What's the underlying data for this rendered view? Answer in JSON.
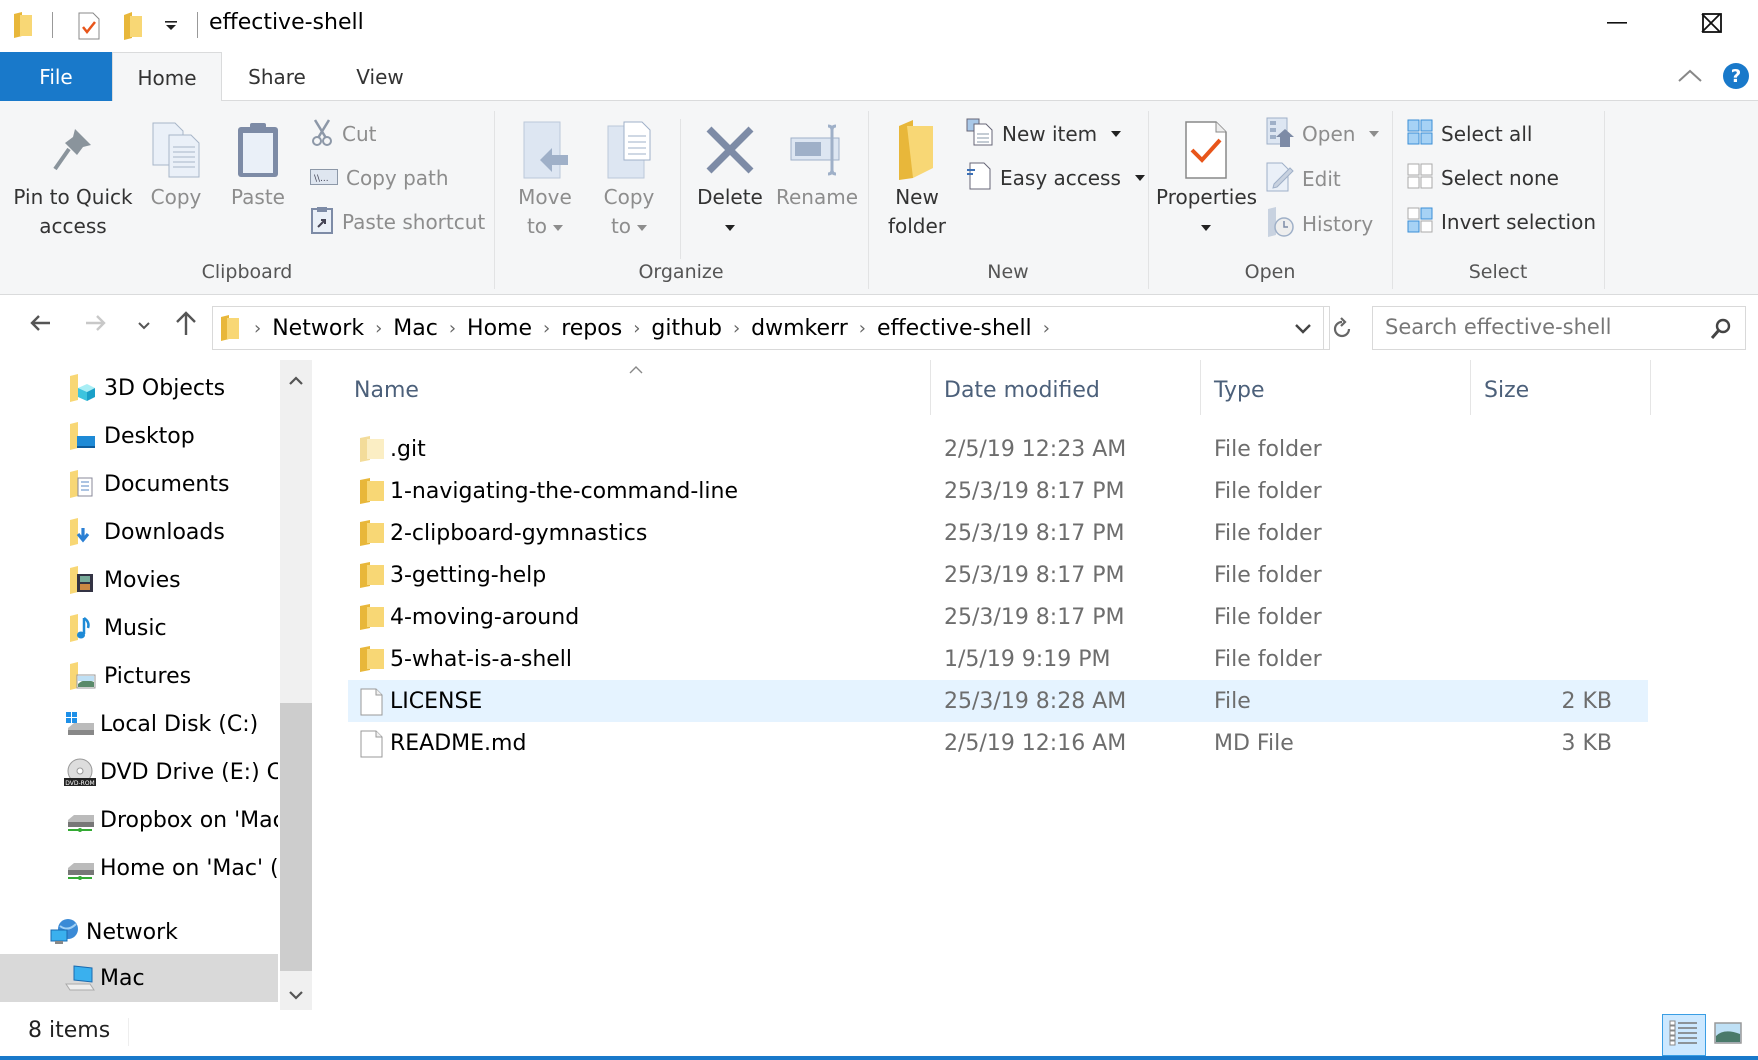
{
  "window": {
    "title": "effective-shell",
    "controls": {
      "minimize": "minimize",
      "maximize": "maximize",
      "close": "close"
    }
  },
  "quick_access_toolbar": {
    "icons": [
      "folder-icon",
      "properties-icon",
      "new-folder-icon",
      "customize-dropdown-icon"
    ]
  },
  "ribbon_tabs": [
    {
      "label": "File"
    },
    {
      "label": "Home",
      "active": true
    },
    {
      "label": "Share"
    },
    {
      "label": "View"
    }
  ],
  "ribbon": {
    "clipboard": {
      "label": "Clipboard",
      "pin_to_quick_access": [
        "Pin to Quick",
        "access"
      ],
      "copy": "Copy",
      "paste": "Paste",
      "cut": "Cut",
      "copy_path": "Copy path",
      "paste_shortcut": "Paste shortcut"
    },
    "organize": {
      "label": "Organize",
      "move_to": [
        "Move",
        "to"
      ],
      "copy_to": [
        "Copy",
        "to"
      ],
      "delete": "Delete",
      "rename": "Rename"
    },
    "new": {
      "label": "New",
      "new_folder": [
        "New",
        "folder"
      ],
      "new_item": "New item",
      "easy_access": "Easy access"
    },
    "open": {
      "label": "Open",
      "properties": "Properties",
      "open": "Open",
      "edit": "Edit",
      "history": "History"
    },
    "select": {
      "label": "Select",
      "select_all": "Select all",
      "select_none": "Select none",
      "invert_selection": "Invert selection"
    }
  },
  "address_bar": {
    "breadcrumbs": [
      "Network",
      "Mac",
      "Home",
      "repos",
      "github",
      "dwmkerr",
      "effective-shell"
    ]
  },
  "search": {
    "placeholder": "Search effective-shell",
    "value": ""
  },
  "sidebar": {
    "items": [
      {
        "label": "3D Objects",
        "icon": "3d-objects-icon"
      },
      {
        "label": "Desktop",
        "icon": "desktop-icon"
      },
      {
        "label": "Documents",
        "icon": "documents-icon"
      },
      {
        "label": "Downloads",
        "icon": "downloads-icon"
      },
      {
        "label": "Movies",
        "icon": "movies-icon"
      },
      {
        "label": "Music",
        "icon": "music-icon"
      },
      {
        "label": "Pictures",
        "icon": "pictures-icon"
      },
      {
        "label": "Local Disk (C:)",
        "icon": "local-disk-icon"
      },
      {
        "label": "DVD Drive (E:) CD",
        "icon": "dvd-drive-icon"
      },
      {
        "label": "Dropbox on 'Mac",
        "icon": "network-drive-icon"
      },
      {
        "label": "Home on 'Mac' (",
        "icon": "network-drive-icon"
      },
      {
        "label": "Network",
        "icon": "network-icon"
      },
      {
        "label": "Mac",
        "icon": "computer-icon",
        "selected": true
      }
    ]
  },
  "file_list": {
    "columns": [
      "Name",
      "Date modified",
      "Type",
      "Size"
    ],
    "sort_column": "Name",
    "rows": [
      {
        "name": ".git",
        "date": "2/5/19 12:23 AM",
        "type": "File folder",
        "size": "",
        "icon": "folder-hidden-icon"
      },
      {
        "name": "1-navigating-the-command-line",
        "date": "25/3/19 8:17 PM",
        "type": "File folder",
        "size": "",
        "icon": "folder-icon"
      },
      {
        "name": "2-clipboard-gymnastics",
        "date": "25/3/19 8:17 PM",
        "type": "File folder",
        "size": "",
        "icon": "folder-icon"
      },
      {
        "name": "3-getting-help",
        "date": "25/3/19 8:17 PM",
        "type": "File folder",
        "size": "",
        "icon": "folder-icon"
      },
      {
        "name": "4-moving-around",
        "date": "25/3/19 8:17 PM",
        "type": "File folder",
        "size": "",
        "icon": "folder-icon"
      },
      {
        "name": "5-what-is-a-shell",
        "date": "1/5/19 9:19 PM",
        "type": "File folder",
        "size": "",
        "icon": "folder-icon"
      },
      {
        "name": "LICENSE",
        "date": "25/3/19 8:28 AM",
        "type": "File",
        "size": "2 KB",
        "icon": "file-icon",
        "selected": true
      },
      {
        "name": "README.md",
        "date": "2/5/19 12:16 AM",
        "type": "MD File",
        "size": "3 KB",
        "icon": "file-icon"
      }
    ]
  },
  "status_bar": {
    "item_count": "8 items",
    "views": [
      "details-view",
      "large-icons-view"
    ],
    "active_view": "details-view"
  },
  "colors": {
    "accent": "#1979ca",
    "selection": "#e5f3ff",
    "sidebar_selection": "#d9d9d9",
    "folder": "#f8d775",
    "header_text": "#4c607a"
  }
}
